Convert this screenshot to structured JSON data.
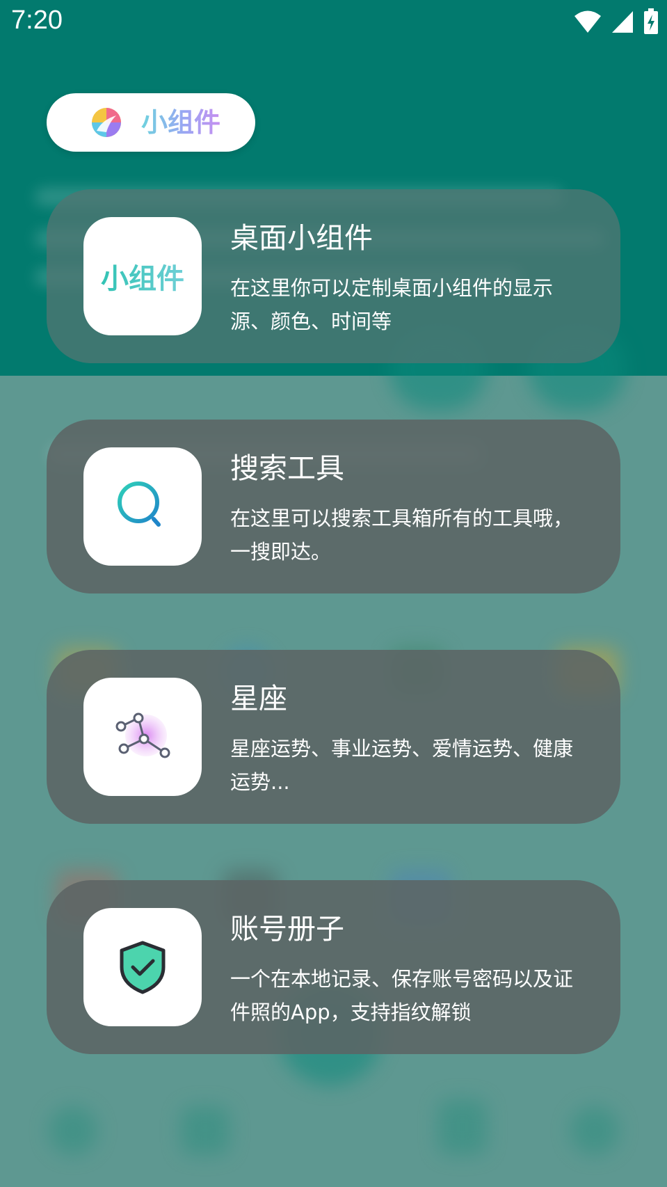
{
  "status_bar": {
    "time": "7:20",
    "icons": [
      "wifi-icon",
      "signal-icon",
      "battery-charging-icon"
    ]
  },
  "header": {
    "title": "小组件",
    "logo_icon": "rainbow-logo-icon"
  },
  "cards": [
    {
      "title": "桌面小组件",
      "description": "在这里你可以定制桌面小组件的显示源、颜色、时间等",
      "icon_text": "小组件",
      "icon": "widget-text-icon"
    },
    {
      "title": "搜索工具",
      "description": "在这里可以搜索工具箱所有的工具哦，一搜即达。",
      "icon": "search-icon"
    },
    {
      "title": "星座",
      "description": "星座运势、事业运势、爱情运势、健康运势...",
      "icon": "constellation-icon"
    },
    {
      "title": "账号册子",
      "description": "一个在本地记录、保存账号密码以及证件照的App，支持指纹解锁",
      "icon": "shield-check-icon"
    }
  ],
  "colors": {
    "top_background": "#027a6e",
    "bottom_background": "#5e9891",
    "card_background": "#5c6464",
    "accent_teal": "#32c3b4"
  }
}
